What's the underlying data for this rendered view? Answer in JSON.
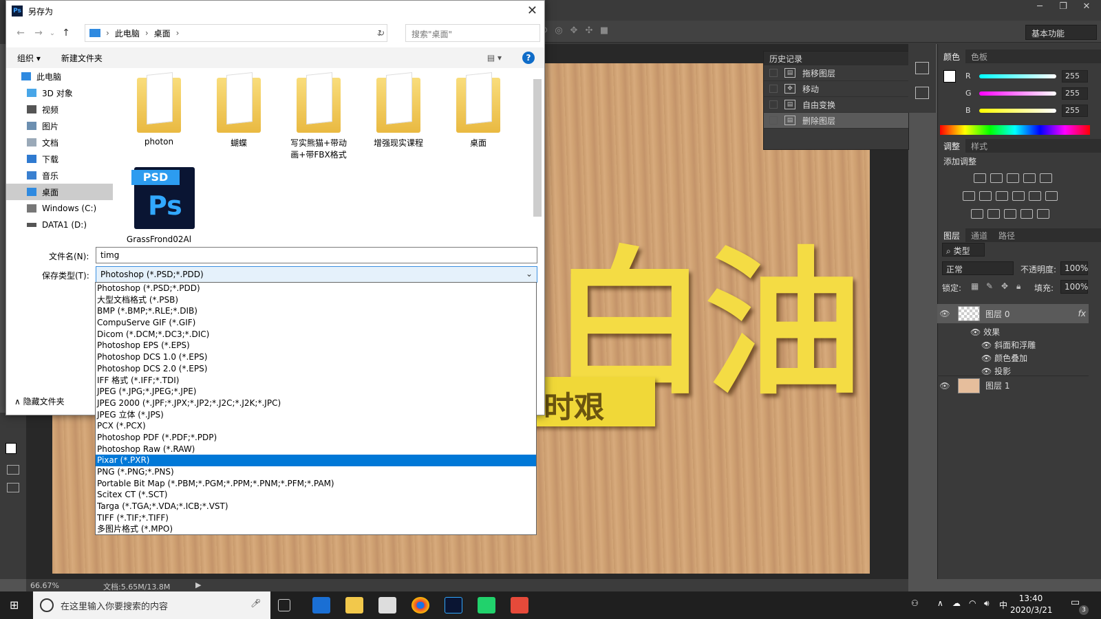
{
  "ps": {
    "workspace": "基本功能",
    "zoom": "66.67%",
    "doc": "文档:5.65M/13.8M",
    "big_text": "白油",
    "banner_text": "时艰"
  },
  "history": {
    "title": "历史记录",
    "items": [
      "拖移图层",
      "移动",
      "自由变换",
      "删除图层"
    ]
  },
  "color_panel": {
    "tabs": [
      "颜色",
      "色板"
    ],
    "r": "255",
    "g": "255",
    "b": "255",
    "r_label": "R",
    "g_label": "G",
    "b_label": "B"
  },
  "adjust_panel": {
    "tabs": [
      "调整",
      "样式"
    ],
    "title": "添加调整"
  },
  "layers_panel": {
    "tabs": [
      "图层",
      "通道",
      "路径"
    ],
    "filter": "类型",
    "blend": "正常",
    "opacity_label": "不透明度:",
    "opacity": "100%",
    "lock_label": "锁定:",
    "fill_label": "填充:",
    "fill": "100%",
    "layers": [
      {
        "name": "图层 0"
      },
      {
        "name": "图层 1"
      }
    ],
    "effects_label": "效果",
    "effects": [
      "斜面和浮雕",
      "颜色叠加",
      "投影"
    ],
    "fx": "fx"
  },
  "dialog": {
    "title": "另存为",
    "path": [
      "此电脑",
      "桌面"
    ],
    "search_placeholder": "搜索\"桌面\"",
    "organize": "组织 ▾",
    "new_folder": "新建文件夹",
    "nav": [
      "此电脑",
      "3D 对象",
      "视频",
      "图片",
      "文档",
      "下载",
      "音乐",
      "桌面",
      "Windows (C:)",
      "DATA1 (D:)"
    ],
    "files": [
      "photon",
      "蝴蝶",
      "写实熊猫+带动画+带FBX格式",
      "增强现实课程",
      "桌面",
      "GrassFrond02Al"
    ],
    "psd_tag": "PSD",
    "psd_ps": "Ps",
    "filename_label": "文件名(N):",
    "filename": "timg",
    "filetype_label": "保存类型(T):",
    "filetype": "Photoshop (*.PSD;*.PDD)",
    "hide_folders": "隐藏文件夹",
    "help": "?"
  },
  "dropdown": {
    "options": [
      "Photoshop (*.PSD;*.PDD)",
      "大型文档格式 (*.PSB)",
      "BMP (*.BMP;*.RLE;*.DIB)",
      "CompuServe GIF (*.GIF)",
      "Dicom (*.DCM;*.DC3;*.DIC)",
      "Photoshop EPS (*.EPS)",
      "Photoshop DCS 1.0 (*.EPS)",
      "Photoshop DCS 2.0 (*.EPS)",
      "IFF 格式 (*.IFF;*.TDI)",
      "JPEG (*.JPG;*.JPEG;*.JPE)",
      "JPEG 2000 (*.JPF;*.JPX;*.JP2;*.J2C;*.J2K;*.JPC)",
      "JPEG 立体 (*.JPS)",
      "PCX (*.PCX)",
      "Photoshop PDF (*.PDF;*.PDP)",
      "Photoshop Raw (*.RAW)",
      "Pixar (*.PXR)",
      "PNG (*.PNG;*.PNS)",
      "Portable Bit Map (*.PBM;*.PGM;*.PPM;*.PNM;*.PFM;*.PAM)",
      "Scitex CT (*.SCT)",
      "Targa (*.TGA;*.VDA;*.ICB;*.VST)",
      "TIFF (*.TIF;*.TIFF)",
      "多图片格式 (*.MPO)"
    ],
    "selected_index": 15
  },
  "taskbar": {
    "search": "在这里输入你要搜索的内容",
    "time": "13:40",
    "date": "2020/3/21",
    "ime": "中",
    "notif": "3"
  }
}
